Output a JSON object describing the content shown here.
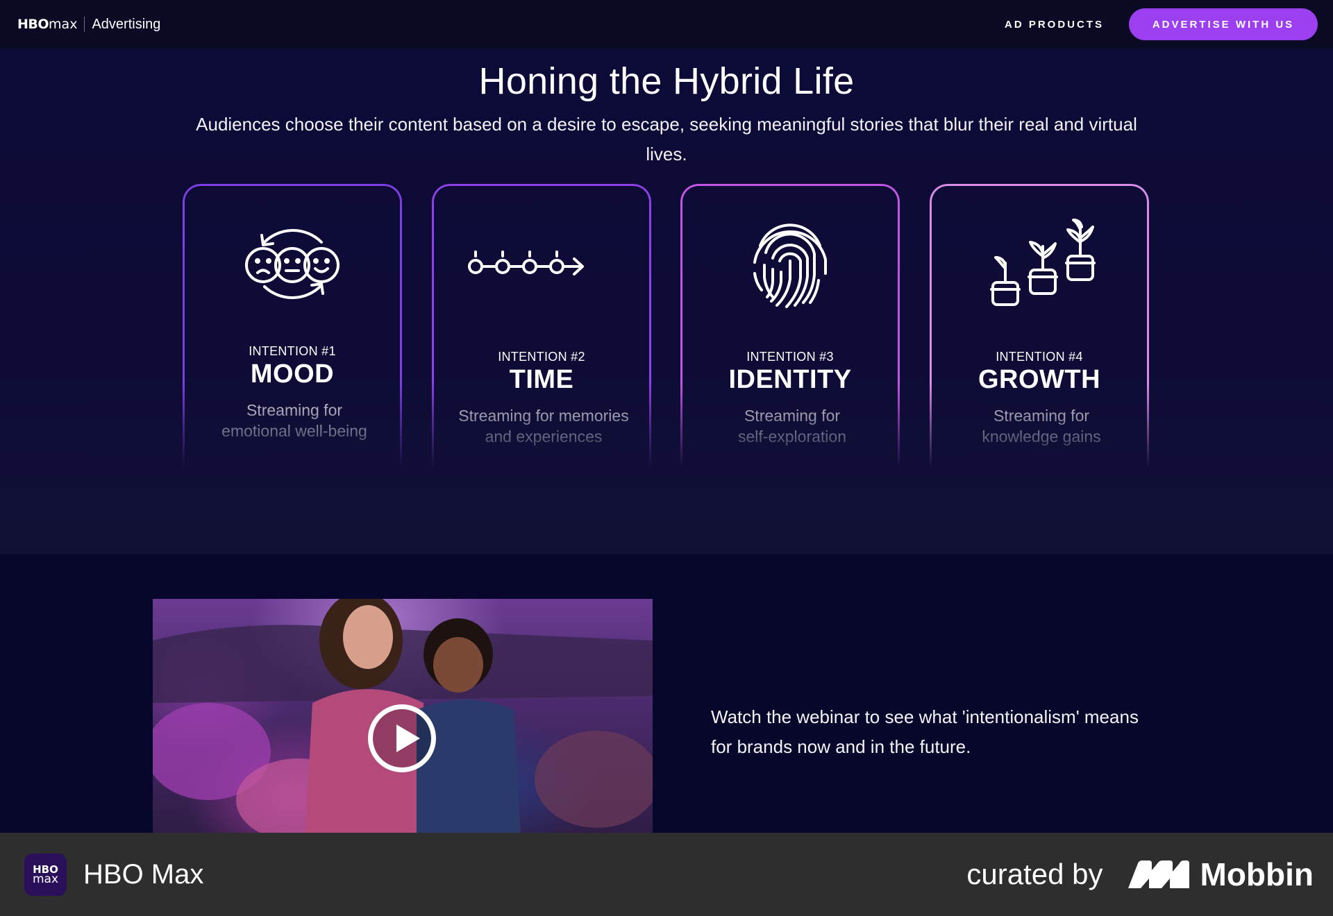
{
  "nav": {
    "logo_bold": "HBO",
    "logo_thin": "max",
    "section": "Advertising",
    "links": [
      "AD PRODUCTS"
    ],
    "cta_label": "ADVERTISE WITH US"
  },
  "hero": {
    "title": "Honing the Hybrid Life",
    "subtitle": "Audiences choose their content based on a desire to escape, seeking meaningful stories that blur their real and virtual lives."
  },
  "cards": [
    {
      "kicker": "INTENTION #1",
      "heading": "MOOD",
      "desc_line1": "Streaming for",
      "desc_line2": "emotional well-being",
      "icon": "moods-cycle-icon",
      "border_color": "#7b3fe4"
    },
    {
      "kicker": "INTENTION #2",
      "heading": "TIME",
      "desc_line1": "Streaming for memories",
      "desc_line2": "and experiences",
      "icon": "timeline-icon",
      "border_color": "#8f3fe6"
    },
    {
      "kicker": "INTENTION #3",
      "heading": "IDENTITY",
      "desc_line1": "Streaming for",
      "desc_line2": "self-exploration",
      "icon": "fingerprint-icon",
      "border_color": "#c257e6"
    },
    {
      "kicker": "INTENTION #4",
      "heading": "GROWTH",
      "desc_line1": "Streaming for",
      "desc_line2": "knowledge gains",
      "icon": "plants-growth-icon",
      "border_color": "#d98de6"
    }
  ],
  "webinar": {
    "text": "Watch the webinar to see what 'intentionalism' means for brands now and in the future.",
    "play_icon": "play-icon"
  },
  "footer": {
    "badge_top": "HBO",
    "badge_bottom": "max",
    "app_name": "HBO Max",
    "curated_by": "curated by",
    "brand": "Mobbin"
  }
}
